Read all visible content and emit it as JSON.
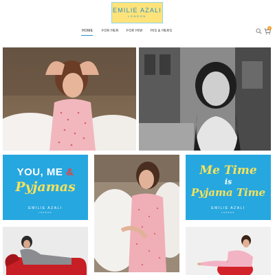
{
  "header": {
    "logo_name": "EMILIE AZALI",
    "logo_city": "LONDON"
  },
  "nav": {
    "items": [
      {
        "label": "HOME",
        "active": true
      },
      {
        "label": "FOR HER",
        "active": false
      },
      {
        "label": "FOR HIM",
        "active": false
      },
      {
        "label": "HIS & HERS",
        "active": false
      }
    ]
  },
  "cart": {
    "count": "0"
  },
  "icons": {
    "search": "search-icon",
    "cart": "cart-icon"
  },
  "promos": {
    "you_me_pyjamas": {
      "line1": "YOU, ME",
      "amp": "&",
      "line2": "Pyjamas",
      "brand": "EMILIE AZALI",
      "city": "LONDON"
    },
    "me_time": {
      "line1": "Me Time",
      "line2": "is",
      "line3": "Pyjama Time",
      "brand": "EMILIE AZALI",
      "city": "LONDON"
    }
  },
  "colors": {
    "accent_blue": "#27a7df",
    "logo_yellow": "#fde37a",
    "promo_yellow": "#f7e25a",
    "promo_red": "#e8413c",
    "badge_orange": "#f39c2b"
  }
}
